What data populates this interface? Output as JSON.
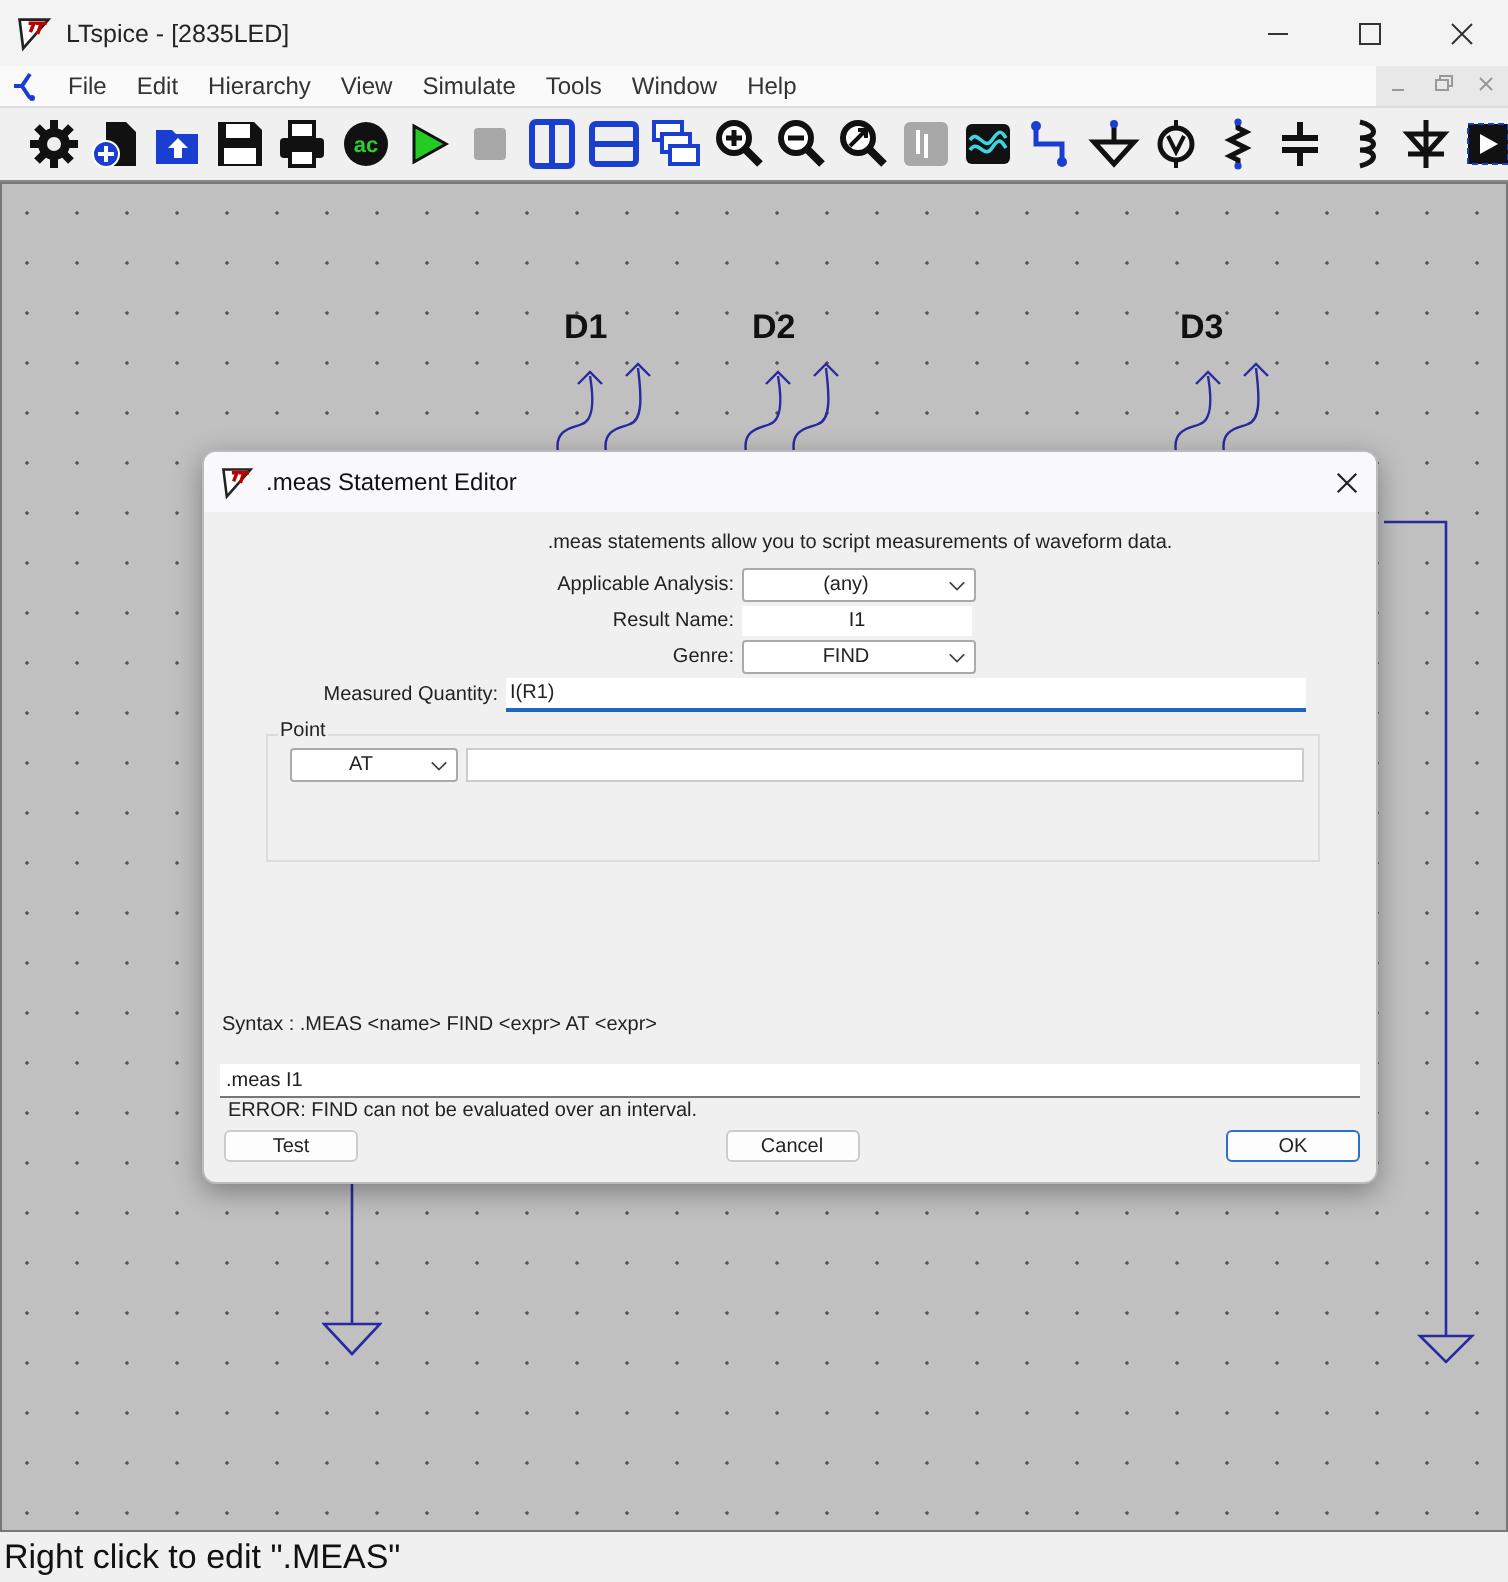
{
  "window": {
    "title": "LTspice - [2835LED]"
  },
  "menu": [
    "File",
    "Edit",
    "Hierarchy",
    "View",
    "Simulate",
    "Tools",
    "Window",
    "Help"
  ],
  "toolbar": {
    "ac_label": "ac",
    "run_disabled": false,
    "stop_disabled": true
  },
  "schematic": {
    "labels": [
      {
        "text": "D1"
      },
      {
        "text": "D2"
      },
      {
        "text": "D3"
      }
    ]
  },
  "dialog": {
    "title": ".meas Statement Editor",
    "intro": ".meas statements allow you to script measurements of waveform data.",
    "fields": [
      {
        "label": "Applicable Analysis:",
        "value": "(any)",
        "kind": "dropdown"
      },
      {
        "label": "Result Name:",
        "value": "I1",
        "kind": "text"
      },
      {
        "label": "Genre:",
        "value": "FIND",
        "kind": "dropdown"
      }
    ],
    "measured_quantity": {
      "label": "Measured Quantity:",
      "value": "I(R1)",
      "focused": true
    },
    "point": {
      "title": "Point",
      "mode": "AT"
    },
    "syntax": "Syntax : .MEAS <name> FIND <expr> AT <expr>",
    "command": ".meas I1",
    "error": "ERROR: FIND can not be evaluated over an interval.",
    "buttons": [
      {
        "label": "Test",
        "default": false
      },
      {
        "label": "Cancel",
        "default": false
      },
      {
        "label": "OK",
        "default": true
      }
    ]
  },
  "status_bar": "Right click to edit \".MEAS\""
}
